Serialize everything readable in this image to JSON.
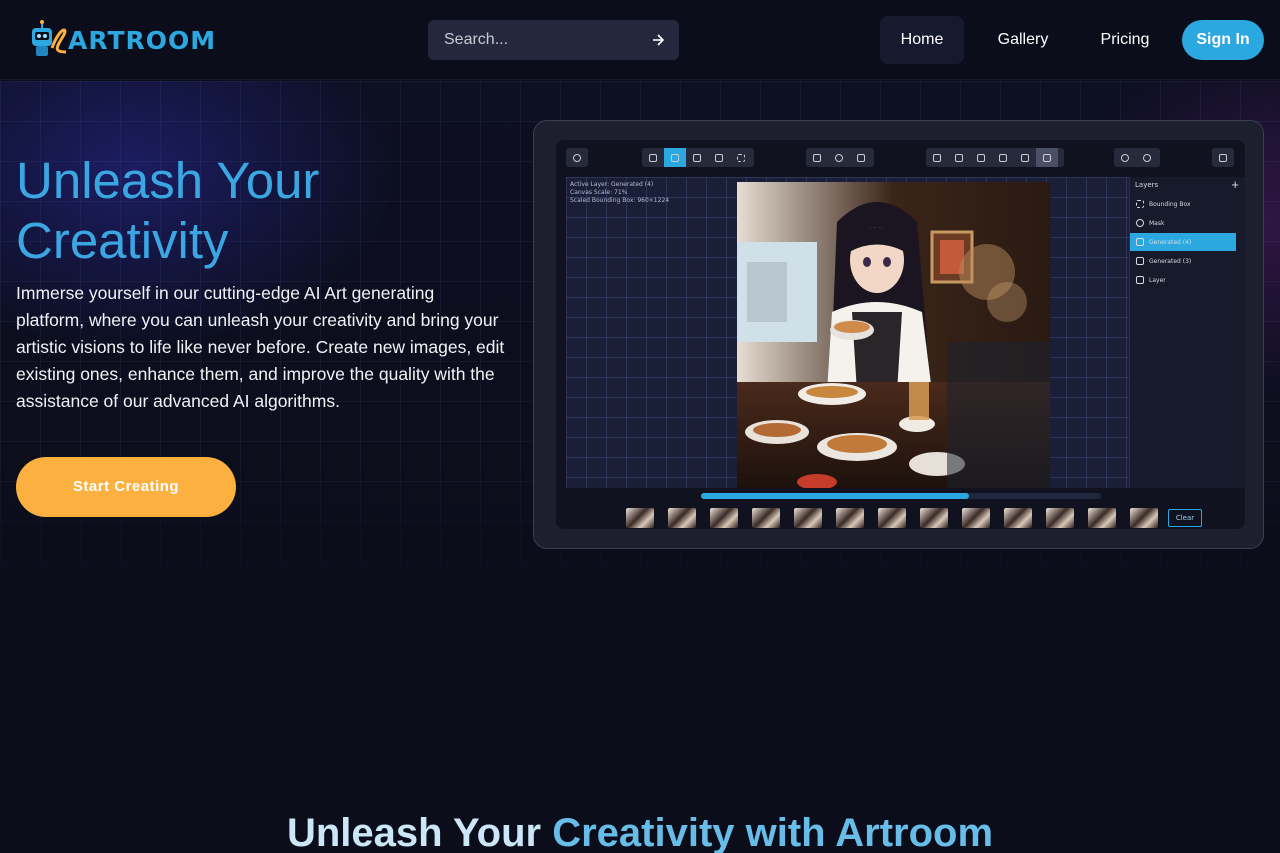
{
  "navbar": {
    "logo_text": "ARTROOM",
    "search": {
      "placeholder": "Search..."
    },
    "links": [
      {
        "label": "Home",
        "active": true
      },
      {
        "label": "Gallery",
        "active": false
      },
      {
        "label": "Pricing",
        "active": false
      }
    ],
    "signin_label": "Sign In"
  },
  "hero": {
    "title": "Unleash Your Creativity",
    "description": "Immerse yourself in our cutting-edge AI Art generating platform, where you can unleash your creativity and bring your artistic visions to life like never before. Create new images, edit existing ones, enhance them, and improve the quality with the assistance of our advanced AI algorithms.",
    "cta_label": "Start Creating"
  },
  "editor_mockup": {
    "info_lines": [
      "Active Layer: Generated (4)",
      "Canvas Scale: 71%",
      "Scaled Bounding Box: 960×1224"
    ],
    "layers_title": "Layers",
    "layers": [
      {
        "label": "Bounding Box",
        "selected": false
      },
      {
        "label": "Mask",
        "selected": false
      },
      {
        "label": "Generated (4)",
        "selected": true
      },
      {
        "label": "Generated (3)",
        "selected": false
      },
      {
        "label": "Layer",
        "selected": false
      }
    ],
    "progress": 0.67,
    "thumbnail_count": 13,
    "clear_label": "Clear"
  },
  "section2": {
    "title_part1": "Unleash Your ",
    "title_part2": "Creativity with Artroom"
  },
  "colors": {
    "accent": "#2ba8e0",
    "cta": "#fbb040",
    "background": "#0b0d1a"
  },
  "icons": [
    "logo-robot-icon",
    "arrow-right-icon"
  ]
}
